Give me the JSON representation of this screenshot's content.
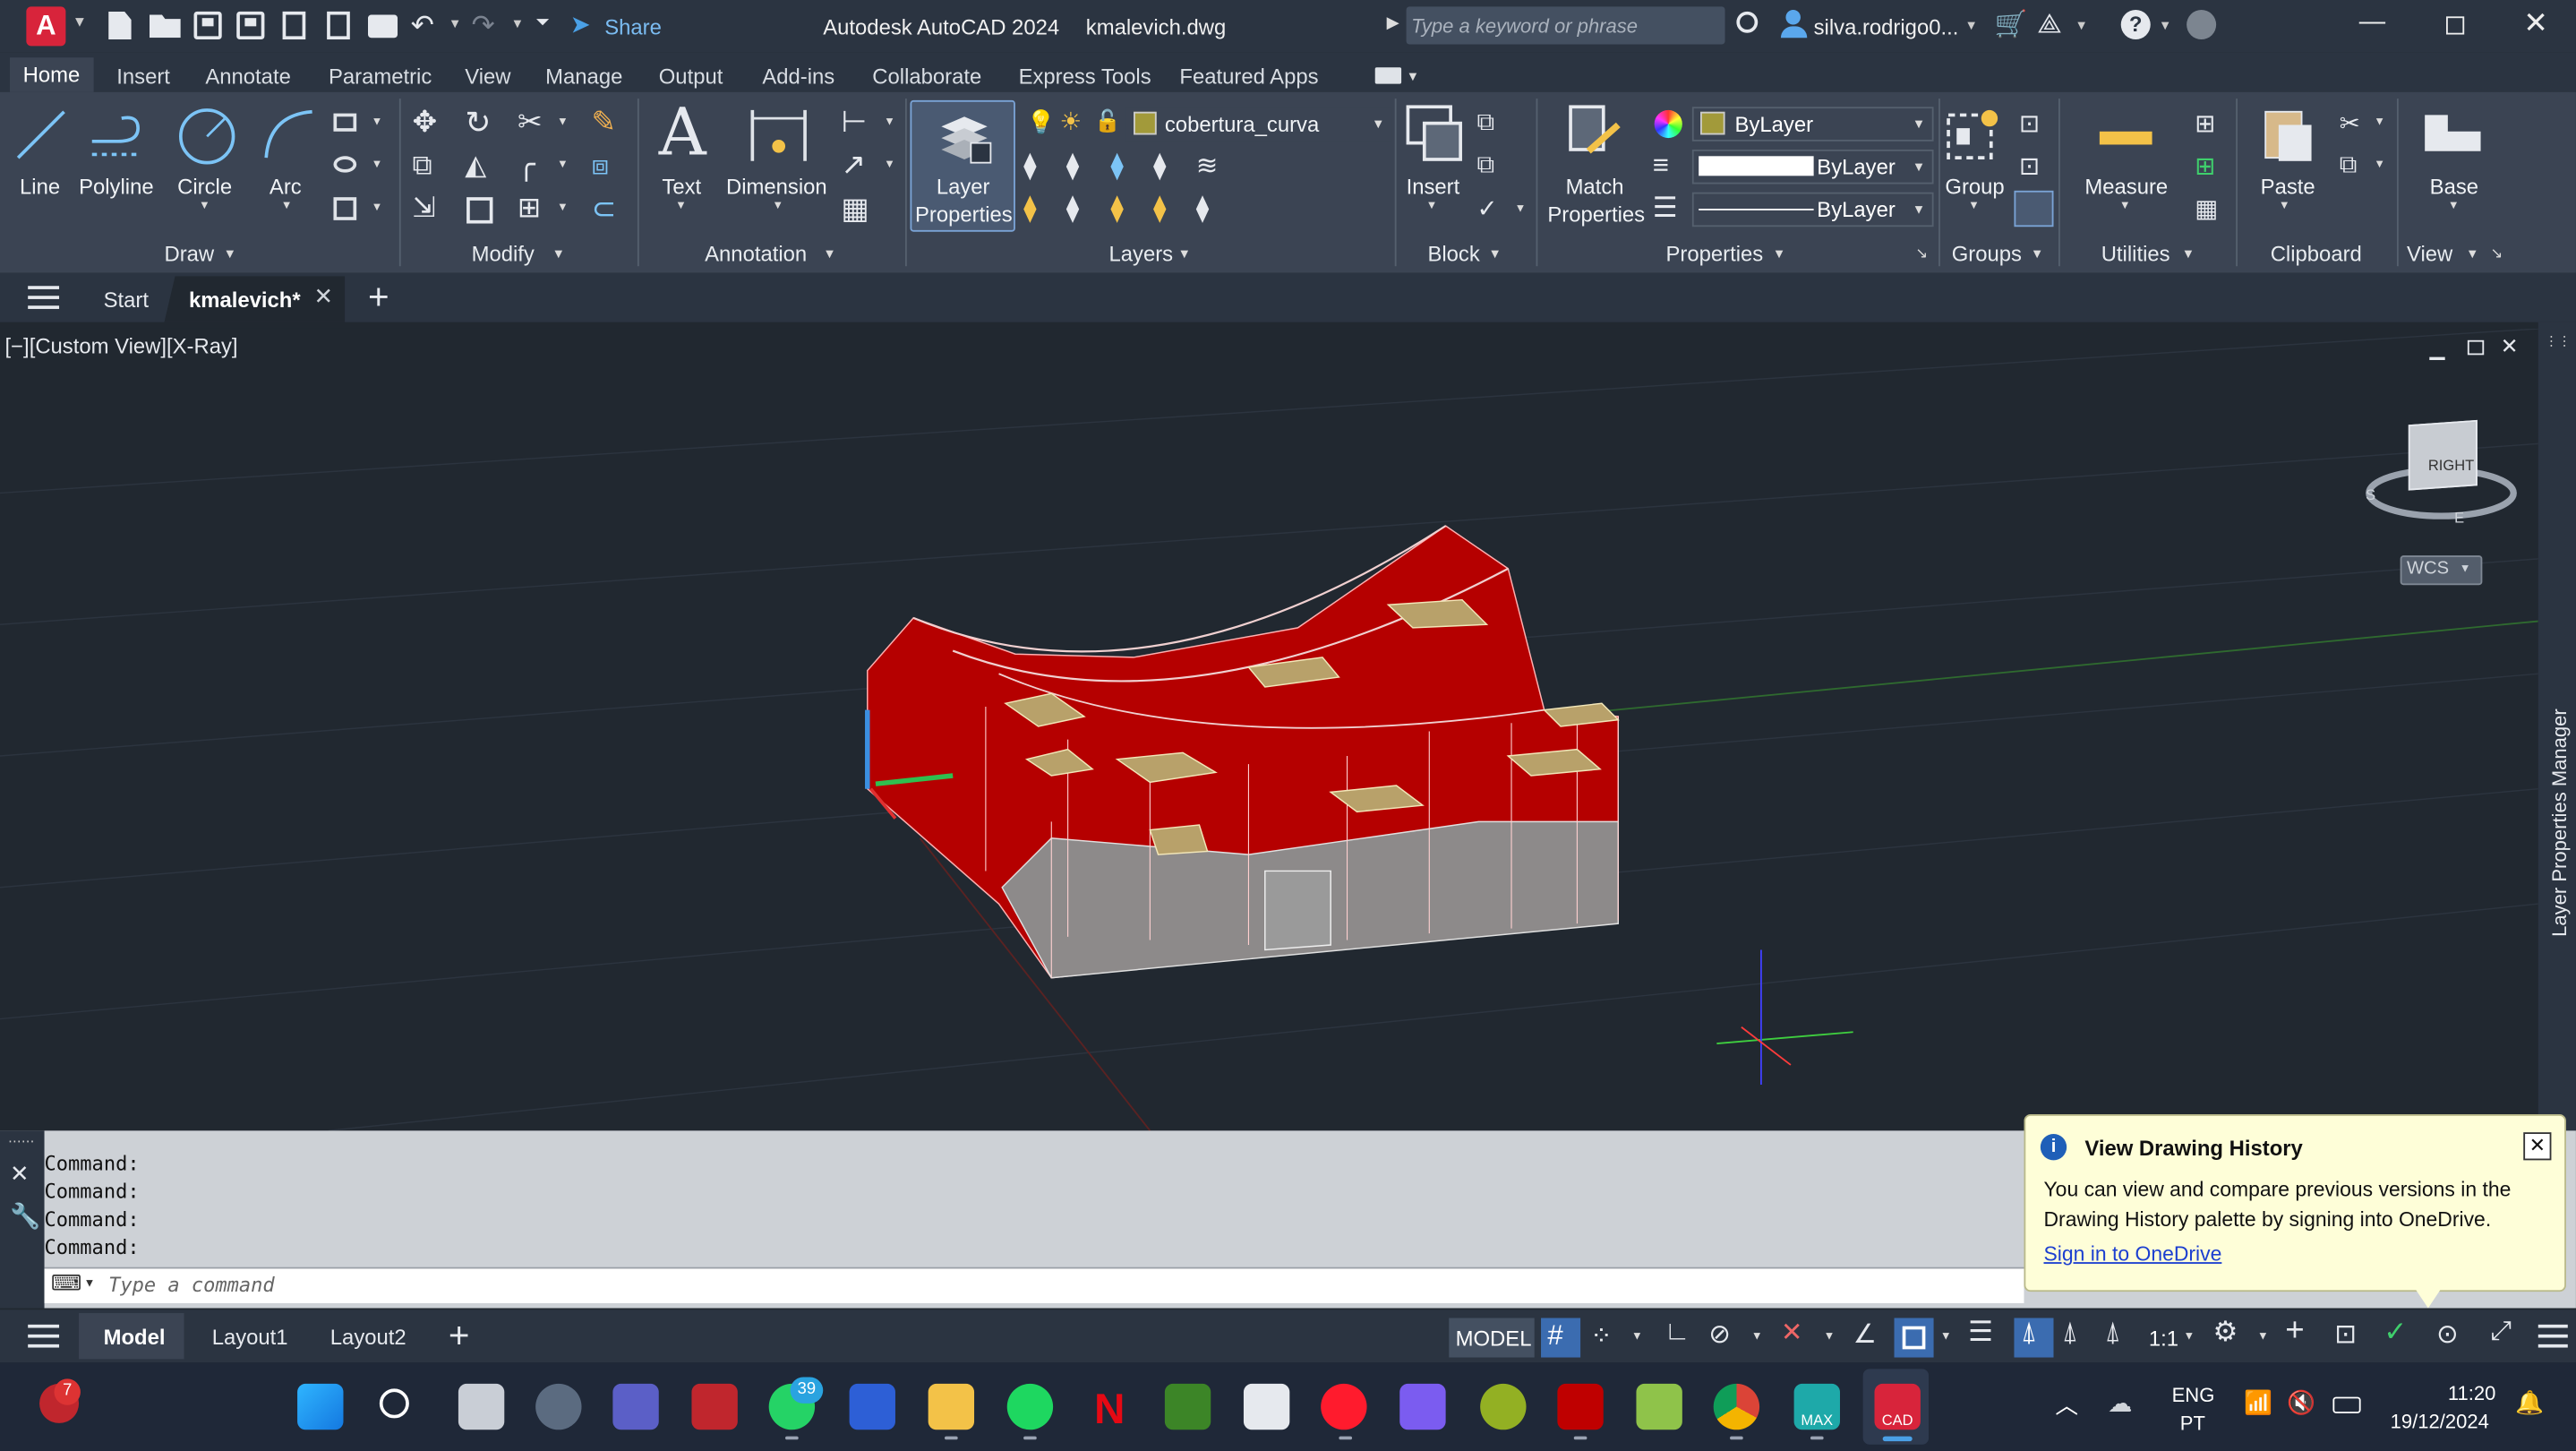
{
  "titlebar": {
    "app_title": "Autodesk AutoCAD 2024",
    "file_name": "kmalevich.dwg",
    "share_label": "Share",
    "search_placeholder": "Type a keyword or phrase",
    "user_name": "silva.rodrigo0..."
  },
  "ribbon_tabs": [
    "Home",
    "Insert",
    "Annotate",
    "Parametric",
    "View",
    "Manage",
    "Output",
    "Add-ins",
    "Collaborate",
    "Express Tools",
    "Featured Apps"
  ],
  "draw_panel": {
    "line": "Line",
    "polyline": "Polyline",
    "circle": "Circle",
    "arc": "Arc",
    "label": "Draw"
  },
  "modify_panel": {
    "label": "Modify"
  },
  "annotation_panel": {
    "text": "Text",
    "dimension": "Dimension",
    "label": "Annotation"
  },
  "layers_panel": {
    "layer_properties_1": "Layer",
    "layer_properties_2": "Properties",
    "current_layer": "cobertura_curva",
    "label": "Layers"
  },
  "block_panel": {
    "insert": "Insert",
    "label": "Block"
  },
  "properties_panel": {
    "match_1": "Match",
    "match_2": "Properties",
    "color": "ByLayer",
    "lineweight": "ByLayer",
    "linetype": "ByLayer",
    "label": "Properties"
  },
  "groups_panel": {
    "group": "Group",
    "label": "Groups"
  },
  "utilities_panel": {
    "measure": "Measure",
    "label": "Utilities"
  },
  "clipboard_panel": {
    "paste": "Paste",
    "label": "Clipboard"
  },
  "view_panel": {
    "base": "Base",
    "label": "View"
  },
  "doc_tabs": {
    "start": "Start",
    "active": "kmalevich*"
  },
  "viewport": {
    "view_label": "[−][Custom View][X-Ray]",
    "viewcube_face": "RIGHT",
    "wcs": "WCS",
    "side_palette": "Layer Properties Manager"
  },
  "command_line": {
    "history": [
      "Command:",
      "Command:",
      "Command:",
      "Command:"
    ],
    "placeholder": "Type a command"
  },
  "notification": {
    "title": "View Drawing History",
    "body": "You can view and compare previous versions in the Drawing History palette by signing into OneDrive.",
    "link": "Sign in to OneDrive"
  },
  "layout_tabs": [
    "Model",
    "Layout1",
    "Layout2"
  ],
  "status": {
    "model": "MODEL",
    "scale": "1:1"
  },
  "taskbar": {
    "mcafee_badge": "7",
    "whatsapp_badge": "39",
    "max_label": "MAX",
    "cad_label": "CAD",
    "lang_1": "ENG",
    "lang_2": "PT",
    "time": "11:20",
    "date": "19/12/2024"
  },
  "colors": {
    "titlebar": "#2b3441",
    "ribbon": "#3b4453",
    "viewport": "#212830",
    "model_red": "#c00000",
    "autocad_red": "#d8243b",
    "accent_blue": "#4aa0e6"
  }
}
